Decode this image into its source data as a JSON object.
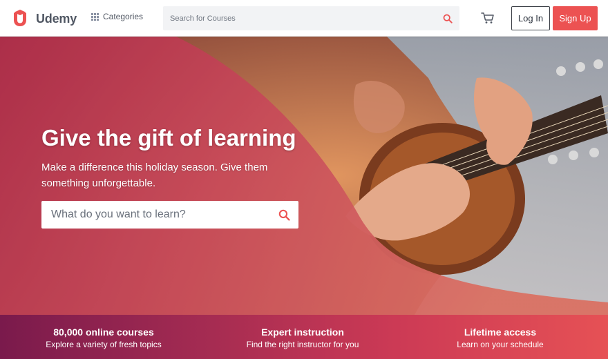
{
  "header": {
    "brand": "Udemy",
    "categories_label": "Categories",
    "search_placeholder": "Search for Courses",
    "login_label": "Log In",
    "signup_label": "Sign Up",
    "icons": [
      "udemy-logo-icon",
      "grid-icon",
      "search-icon",
      "cart-icon"
    ]
  },
  "hero": {
    "title": "Give the gift of learning",
    "subtitle": "Make a difference this holiday season. Give them something unforgettable.",
    "search_placeholder": "What do you want to learn?"
  },
  "features": [
    {
      "title": "80,000 online courses",
      "description": "Explore a variety of fresh topics"
    },
    {
      "title": "Expert instruction",
      "description": "Find the right instructor for you"
    },
    {
      "title": "Lifetime access",
      "description": "Learn on your schedule"
    }
  ],
  "colors": {
    "brand_red": "#ec5252",
    "text_dark": "#29303b",
    "search_bg": "#f2f3f5",
    "features_gradient_start": "#7a1a4c",
    "features_gradient_end": "#e65155"
  }
}
